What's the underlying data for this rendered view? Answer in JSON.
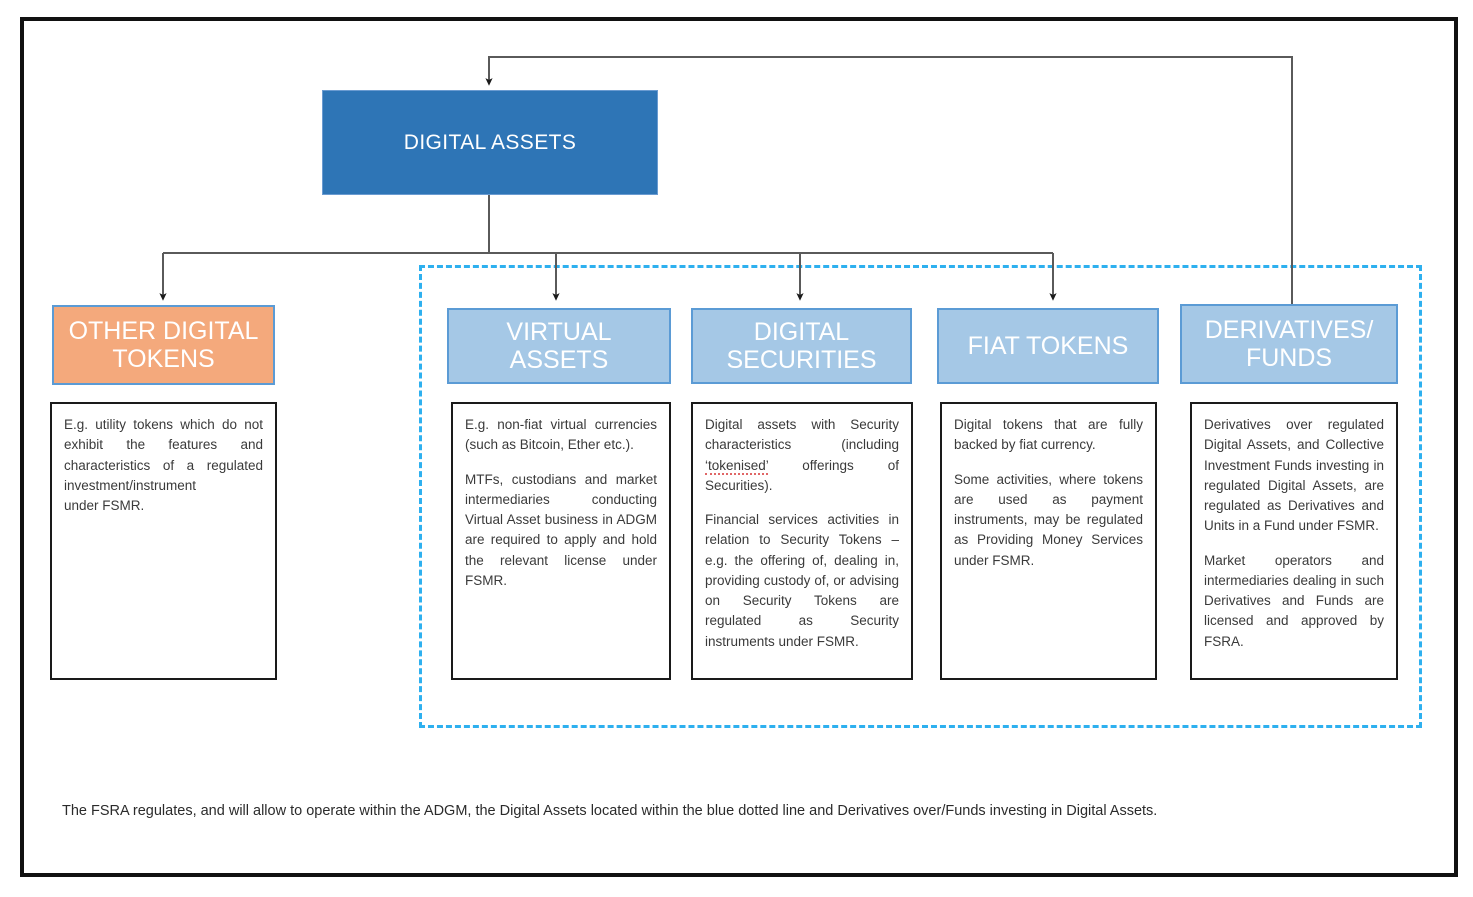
{
  "diagram": {
    "title_node": {
      "label": "DIGITAL ASSETS"
    },
    "categories": [
      {
        "id": "other-digital-tokens",
        "label": "OTHER DIGITAL TOKENS",
        "color": "#f4a97c",
        "inside_regulated_region": false,
        "description_paragraphs": [
          "E.g. utility tokens which do not exhibit the features and characteristics of a regulated investment/instrument",
          "under FSMR."
        ]
      },
      {
        "id": "virtual-assets",
        "label": "VIRTUAL ASSETS",
        "color": "#a5c8e6",
        "inside_regulated_region": true,
        "description_paragraphs": [
          "E.g. non-fiat virtual currencies (such as Bitcoin, Ether etc.).",
          "MTFs, custodians and market intermediaries conducting Virtual Asset business in ADGM are required to apply and hold the relevant license under FSMR."
        ]
      },
      {
        "id": "digital-securities",
        "label": "DIGITAL SECURITIES",
        "color": "#a5c8e6",
        "inside_regulated_region": true,
        "description_paragraphs": [
          "Digital assets with Security characteristics (including ‘tokenised’ offerings of Securities).",
          "Financial services activities in relation to Security Tokens – e.g. the offering of, dealing in, providing custody of, or advising on Security Tokens are regulated as Security instruments under FSMR."
        ],
        "misspelled_word": "‘tokenised’"
      },
      {
        "id": "fiat-tokens",
        "label": "FIAT TOKENS",
        "color": "#a5c8e6",
        "inside_regulated_region": true,
        "description_paragraphs": [
          "Digital tokens that are fully backed by fiat currency.",
          "Some activities, where tokens are used as payment instruments, may be regulated as Providing Money Services under FSMR."
        ]
      },
      {
        "id": "derivatives-funds",
        "label": "DERIVATIVES/ FUNDS",
        "color": "#a5c8e6",
        "inside_regulated_region": true,
        "description_paragraphs": [
          "Derivatives over regulated Digital Assets, and Collective Investment Funds investing in regulated Digital Assets, are regulated as Derivatives and Units in a Fund under FSMR.",
          "Market operators and intermediaries dealing in such Derivatives and Funds are licensed and approved by FSRA."
        ]
      }
    ],
    "footer_note": "The FSRA regulates, and will allow to operate within the ADGM, the Digital Assets located within the blue dotted line and Derivatives over/Funds investing in Digital Assets.",
    "colors": {
      "root_fill": "#2e75b6",
      "category_blue_fill": "#a5c8e6",
      "category_orange_fill": "#f4a97c",
      "category_border": "#5b9bd5",
      "dotted_region_border": "#2eb0ef",
      "connector_line": "#5a5a5a",
      "outer_frame": "#111111"
    }
  }
}
